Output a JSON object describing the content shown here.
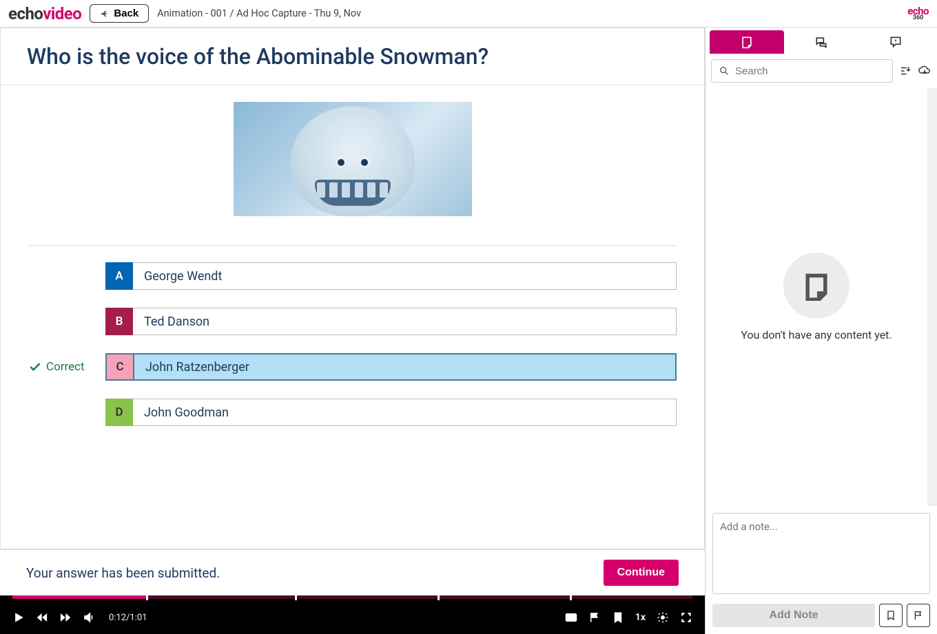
{
  "header": {
    "back_label": "Back",
    "breadcrumb": "Animation - 001 / Ad Hoc Capture - Thu 9, Nov",
    "mini_logo_top": "echo",
    "mini_logo_bottom": "360"
  },
  "question": {
    "title": "Who is the voice of the Abominable Snowman?",
    "correct_label": "Correct",
    "answers": [
      {
        "letter": "A",
        "text": "George Wendt",
        "letter_class": "letter-a",
        "selected": false
      },
      {
        "letter": "B",
        "text": "Ted Danson",
        "letter_class": "letter-b",
        "selected": false
      },
      {
        "letter": "C",
        "text": "John Ratzenberger",
        "letter_class": "letter-c",
        "selected": true
      },
      {
        "letter": "D",
        "text": "John Goodman",
        "letter_class": "letter-d",
        "selected": false
      }
    ],
    "footer_msg": "Your answer has been submitted.",
    "continue_label": "Continue"
  },
  "video": {
    "time": "0:12/1:01",
    "speed": "1x",
    "progress_pct": 19.7,
    "markers_pct": [
      19.7,
      41.5,
      62.5,
      82.0
    ]
  },
  "sidebar": {
    "search_placeholder": "Search",
    "empty_text": "You don't have any content yet.",
    "note_placeholder": "Add a note...",
    "add_note_label": "Add Note"
  }
}
